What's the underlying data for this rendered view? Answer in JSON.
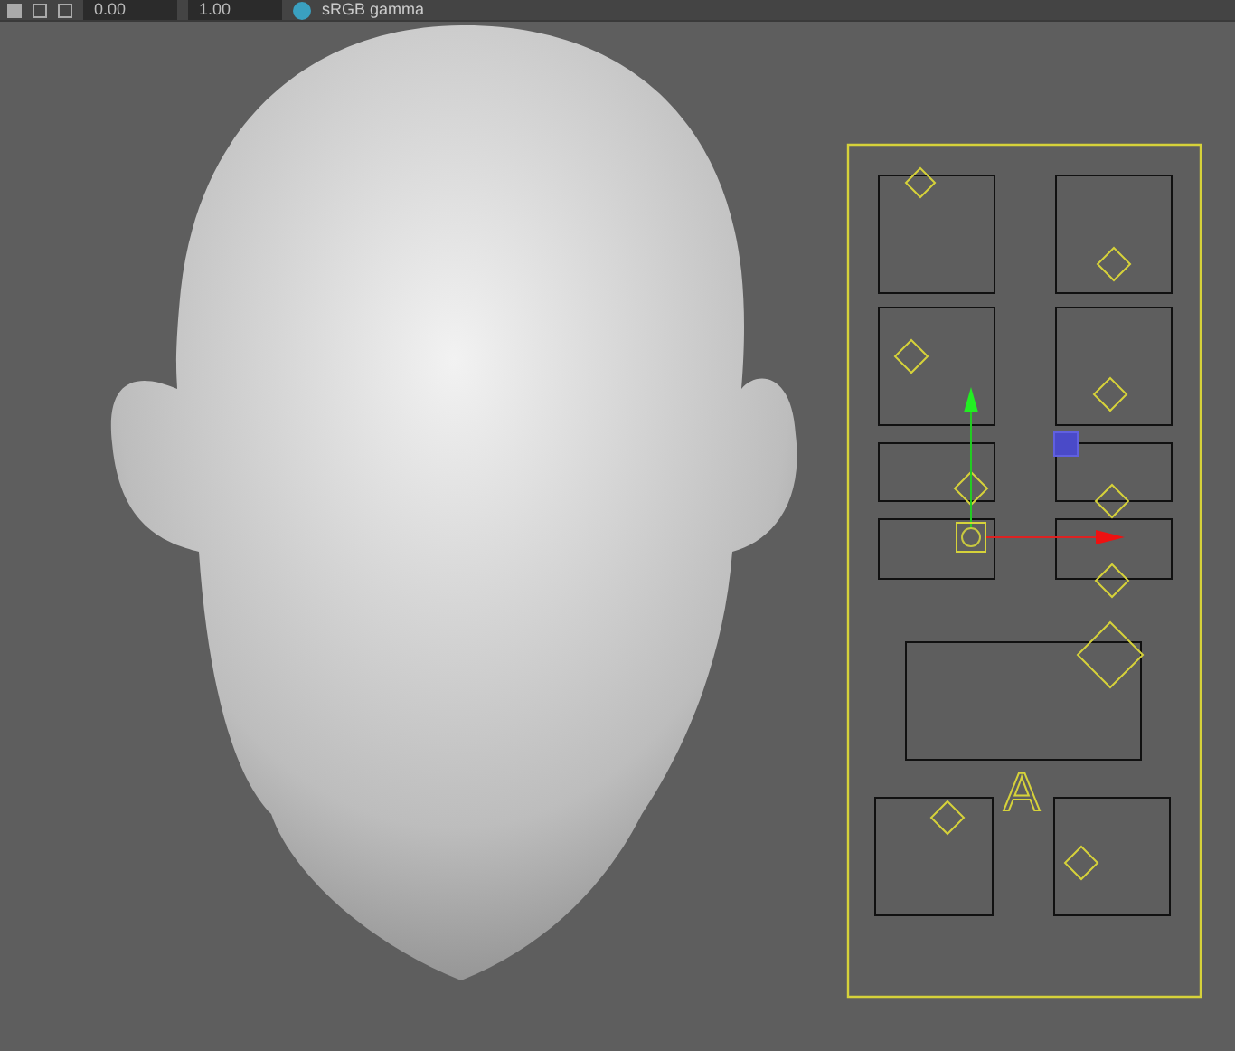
{
  "toolbar": {
    "fields": [
      {
        "value": "0.00"
      },
      {
        "value": "1.00"
      }
    ],
    "color_space": "sRGB gamma"
  },
  "rig": {
    "label": "A"
  }
}
